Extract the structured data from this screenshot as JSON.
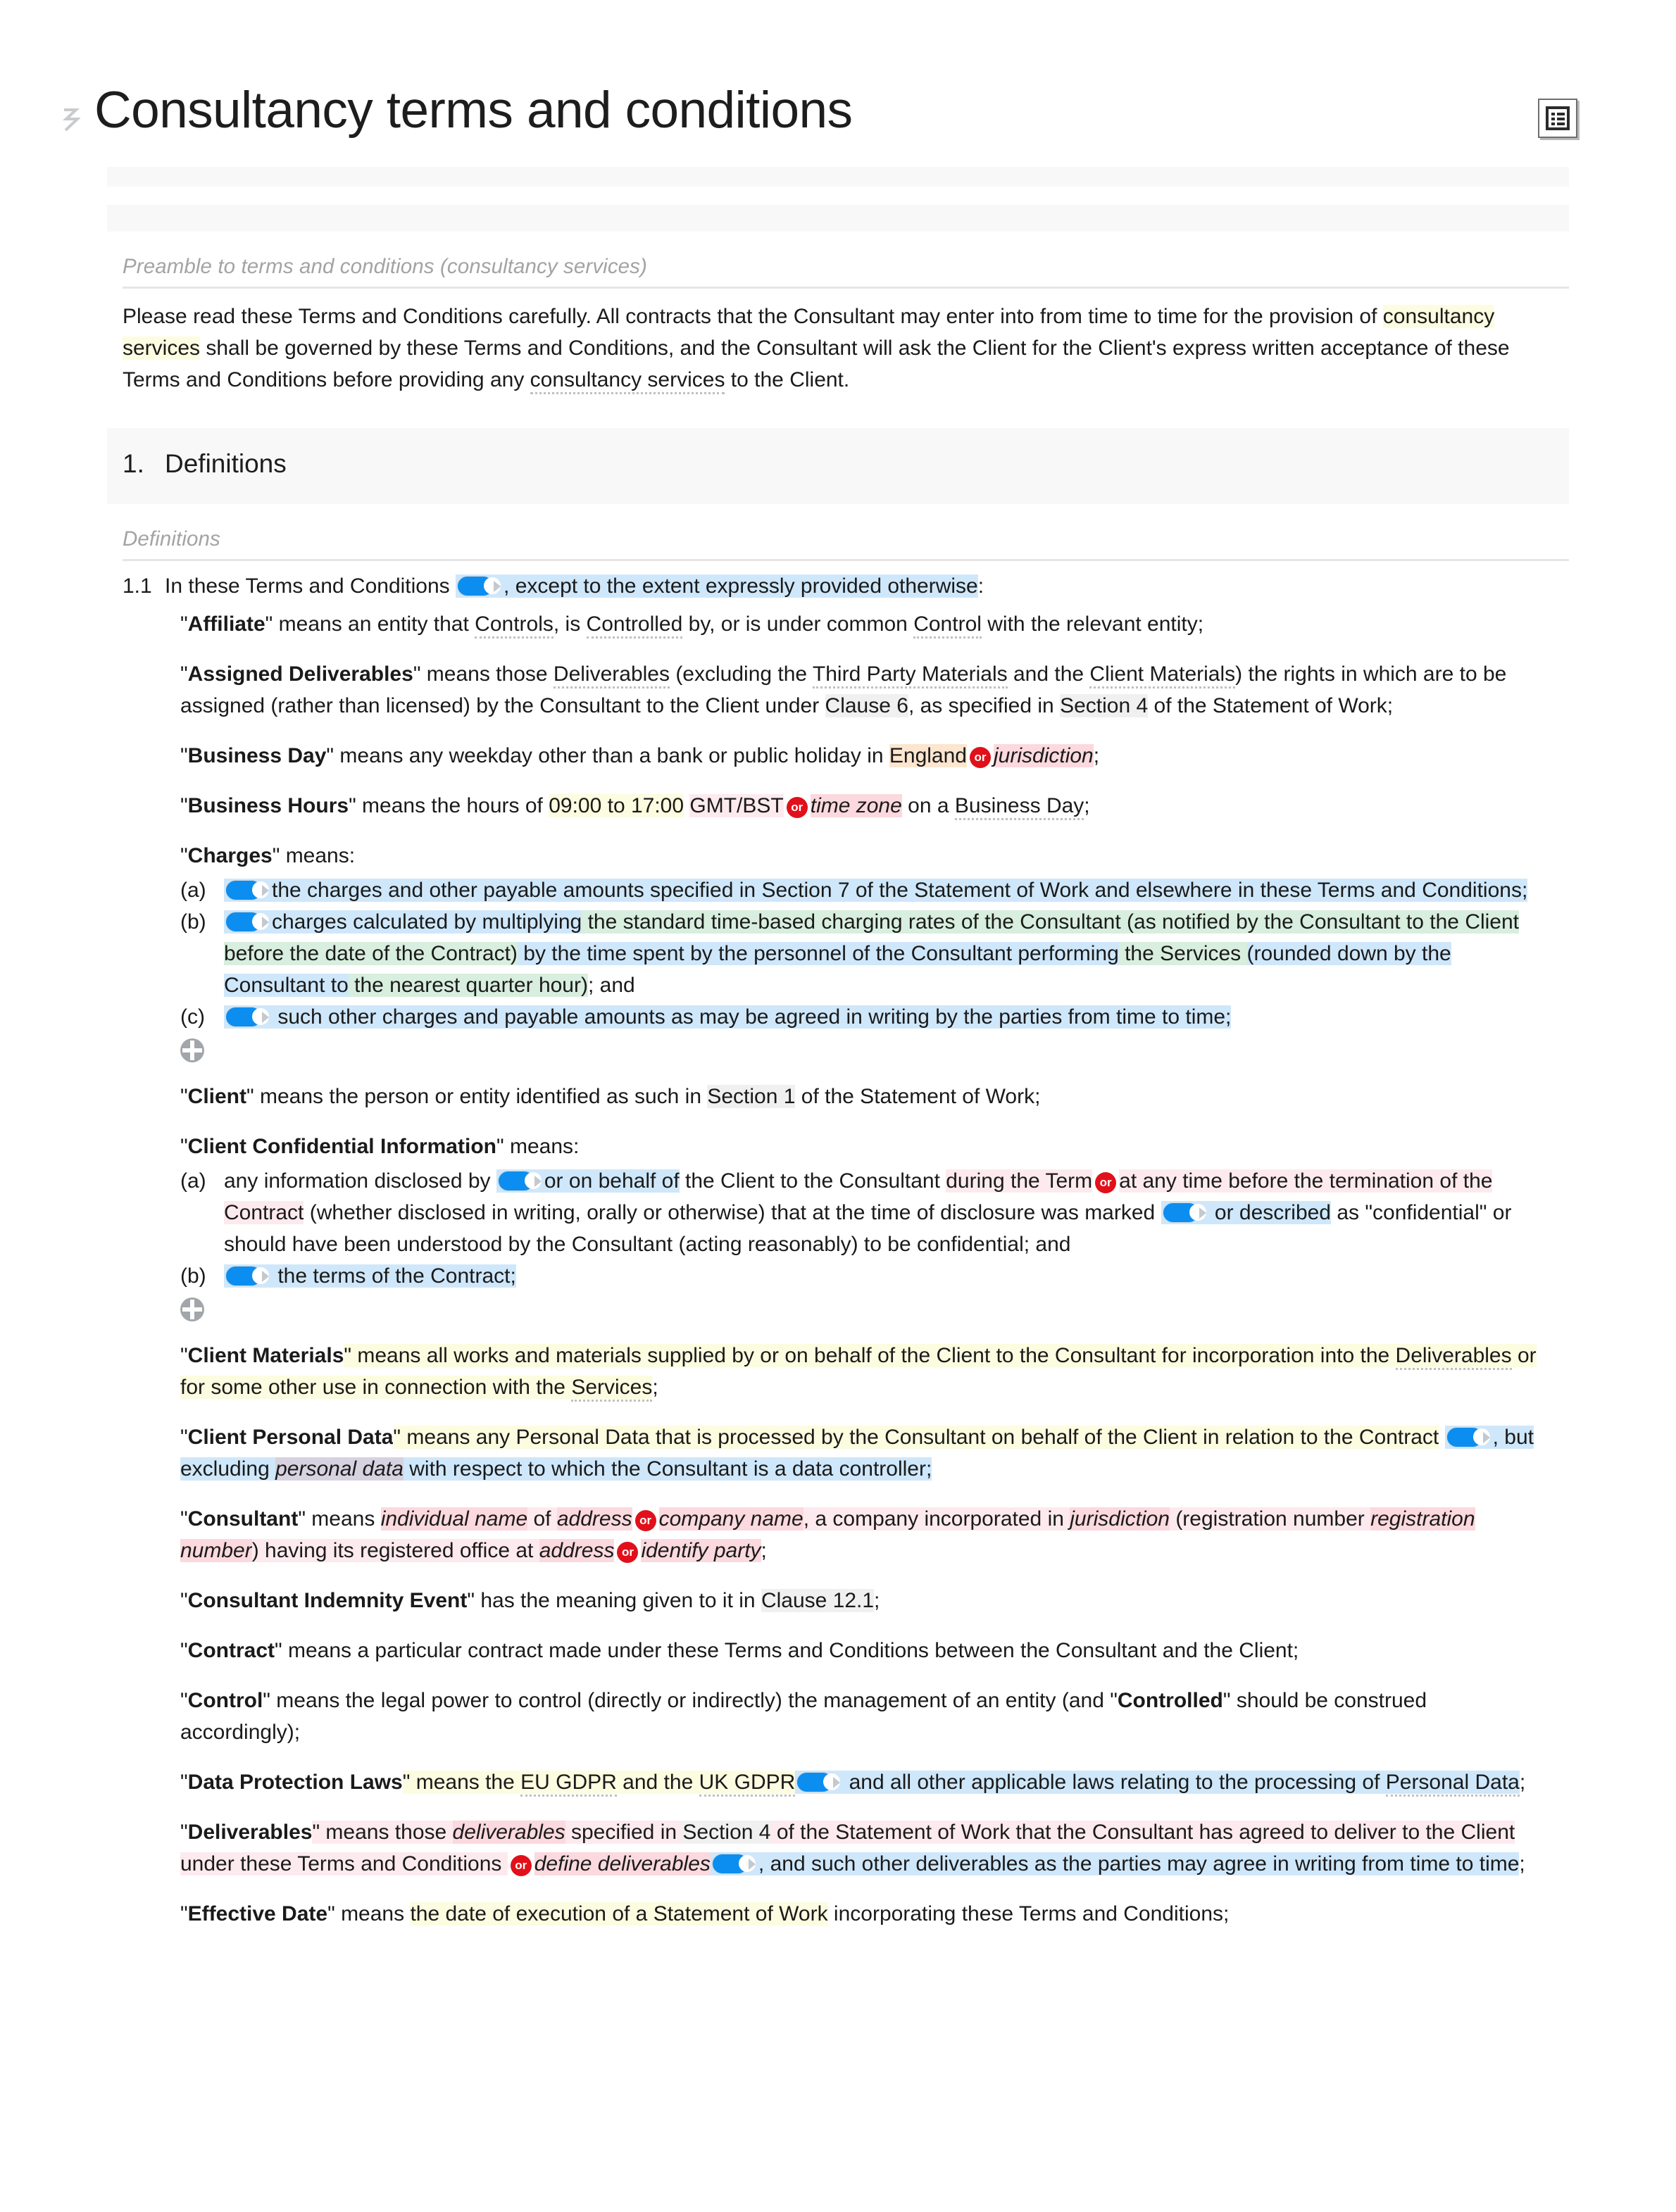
{
  "header": {
    "drag_handle_glyph": "⠿",
    "title": "Consultancy terms and conditions",
    "tool_icon": "list-outline-icon"
  },
  "preamble": {
    "label": "Preamble to terms and conditions (consultancy services)",
    "text_a": "Please read these Terms and Conditions carefully. All contracts that the Consultant may enter into from time to time for the provision of ",
    "hl_consultancy_services": "consultancy services",
    "text_b": " shall be governed by these Terms and Conditions, and the Consultant will ask the Client for the Client's express written acceptance of these Terms and Conditions before providing any ",
    "term_consultancy_services": "consultancy services",
    "text_c": " to the Client."
  },
  "section": {
    "number": "1.",
    "title": "Definitions",
    "label": "Definitions"
  },
  "clause_1_1": {
    "number": "1.1",
    "lead": "In these Terms and Conditions",
    "tail": ", except to the extent expressly provided otherwise",
    "end": ":"
  },
  "definitions": [
    {
      "term": "Affiliate",
      "parts": [
        {
          "t": "\" means an entity that "
        },
        {
          "t": "Controls",
          "style": "dotted"
        },
        {
          "t": ", is "
        },
        {
          "t": "Controlled",
          "style": "dotted"
        },
        {
          "t": " by, or is under common "
        },
        {
          "t": "Control",
          "style": "dotted"
        },
        {
          "t": " with the relevant entity;"
        }
      ]
    },
    {
      "term": "Assigned Deliverables",
      "parts": [
        {
          "t": "\" means those "
        },
        {
          "t": "Deliverables",
          "style": "dotted"
        },
        {
          "t": " (excluding the "
        },
        {
          "t": "Third Party Materials",
          "style": "dotted"
        },
        {
          "t": " and the "
        },
        {
          "t": "Client Materials",
          "style": "dotted"
        },
        {
          "t": ") the rights in which are to be assigned (rather than licensed) by the Consultant to the Client under "
        },
        {
          "t": "Clause 6",
          "style": "hl-gray"
        },
        {
          "t": ", as specified in "
        },
        {
          "t": "Section 4",
          "style": "hl-gray"
        },
        {
          "t": " of the "
        },
        {
          "t": "Statement of Work",
          "style": "plain"
        },
        {
          "t": ";"
        }
      ]
    },
    {
      "term": "Business Day",
      "parts": [
        {
          "t": "\" means any weekday other than a bank or public holiday in "
        },
        {
          "t": "England",
          "style": "hl-peach"
        },
        {
          "t": "OR",
          "style": "or-badge"
        },
        {
          "t": "jurisdiction",
          "style": "hl-pink-italic"
        },
        {
          "t": ";"
        }
      ]
    },
    {
      "term": "Business Hours",
      "parts": [
        {
          "t": "\" means the hours of "
        },
        {
          "t": "09:00 to 17:00",
          "style": "hl-yellow"
        },
        {
          "t": " "
        },
        {
          "t": "GMT/BST",
          "style": "hl-pink-l"
        },
        {
          "t": "OR",
          "style": "or-badge"
        },
        {
          "t": "time zone",
          "style": "hl-pink-italic"
        },
        {
          "t": " on a "
        },
        {
          "t": "Business Day",
          "style": "dotted"
        },
        {
          "t": ";"
        }
      ]
    }
  ],
  "charges": {
    "lead_term": "Charges",
    "lead_rest": "\" means:",
    "items": [
      {
        "label": "(a)",
        "text": "the charges and other payable amounts specified in Section 7 of the Statement of Work and elsewhere in these Terms and Conditions;"
      },
      {
        "label": "(b)",
        "text_blue_1": "charges calculated by multiplying",
        "text_green_1": " the standard time-based charging rates of the Consultant (as notified by the Consultant to the Client before the date of the Contract)",
        "text_blue_2": " by the time spent by the personnel of the Consultant performing",
        "text_green_2": " the Services ",
        "text_blue_3": "(rounded down by the Consultant to",
        "text_green_3": " the nearest quarter hour)",
        "text_plain": "; and"
      },
      {
        "label": "(c)",
        "text": "such other charges and payable amounts as may be agreed in writing by the parties from time to time;"
      }
    ]
  },
  "client_def": {
    "term": "Client",
    "text_a": "\" means the person or entity identified as such in ",
    "ref": "Section 1",
    "text_b": " of the Statement of Work;"
  },
  "cci": {
    "term": "Client Confidential Information",
    "rest": "\" means:",
    "item_a": {
      "label": "(a)",
      "lead": "any information disclosed by ",
      "blue_1": "or on behalf of",
      "mid_1": " the Client to the Consultant ",
      "pink_1": "during the Term",
      "pink_2": "at any time before the termination of the Contract",
      "mid_2": " (whether disclosed in writing, orally or otherwise) that at the time of disclosure was marked ",
      "blue_2": "or described",
      "tail": " as \"confidential\" or should have been understood by the Consultant (acting reasonably) to be confidential; and"
    },
    "item_b": {
      "label": "(b)",
      "text": "the terms of the Contract;"
    }
  },
  "client_materials": {
    "term": "Client Materials",
    "text_a": "\" means all works and materials supplied by or on behalf of the Client to the Consultant for incorporation into the ",
    "ref_1": "Deliverables",
    "text_b": " or for some other use in connection with the ",
    "ref_2": "Services",
    "text_c": ";"
  },
  "client_personal_data": {
    "term": "Client Personal Data",
    "yellow": "\" means any Personal Data that is processed by the Consultant on behalf of the Client in relation to the Contract",
    "ref": "Personal Data",
    "blue_a": ", but excluding ",
    "mauve": "personal data",
    "blue_b": " with respect to which the Consultant is a data controller;"
  },
  "consultant": {
    "term": "Consultant",
    "text_a": "\" means ",
    "p1": "individual name",
    "mid_1": " of ",
    "p2": "address",
    "p3": "company name",
    "mid_2": ", a company incorporated in ",
    "p4": "jurisdiction",
    "mid_3": " (registration number ",
    "p5": "registration number",
    "mid_4": ") having its registered office at ",
    "p6": "address",
    "p7": "identify party",
    "tail": ";"
  },
  "consultant_indemnity": {
    "term": "Consultant Indemnity Event",
    "text_a": "\" has the meaning given to it in ",
    "ref": "Clause 12.1",
    "text_b": ";"
  },
  "contract_def": {
    "term": "Contract",
    "text": "\" means a particular contract made under these Terms and Conditions between the Consultant and the Client;"
  },
  "control_def": {
    "term": "Control",
    "text_a": "\" means the legal power to control (directly or indirectly) the management of an entity (and \"",
    "term_b": "Controlled",
    "text_b": "\" should be construed accordingly);"
  },
  "dpl": {
    "term": "Data Protection Laws",
    "yellow_a": "\" means the ",
    "ref_1": "EU GDPR",
    "yellow_b": " and the ",
    "ref_2": "UK GDPR",
    "blue": " and all other applicable laws relating to the processing of ",
    "ref_3": "Personal Data",
    "tail": ";"
  },
  "deliverables": {
    "term": "Deliverables",
    "text_a": "\" means those ",
    "p1": "deliverables",
    "text_b": " specified in ",
    "ref_1": "Section 4",
    "text_c": " of the Statement of Work that the Consultant has agreed to deliver to the Client under these Terms and Conditions ",
    "p2": "define deliverables",
    "blue": ", and such other deliverables as the parties may agree in writing from time to time",
    "tail": ";"
  },
  "effective_date": {
    "term": "Effective Date",
    "text_a": "\" means ",
    "yellow": "the date of execution of a Statement of Work",
    "ref": "Statement of Work",
    "text_b": " incorporating these Terms and Conditions;"
  },
  "colors": {
    "toggle_on": "#0b8ef0",
    "or_badge": "#e2101a",
    "highlight_yellow": "#fcfce0",
    "highlight_blue": "#cfe7fa",
    "highlight_green": "#d8eede",
    "highlight_pink": "#fbd9de",
    "highlight_peach": "#fce6cf",
    "highlight_gray": "#f0f0f0"
  }
}
